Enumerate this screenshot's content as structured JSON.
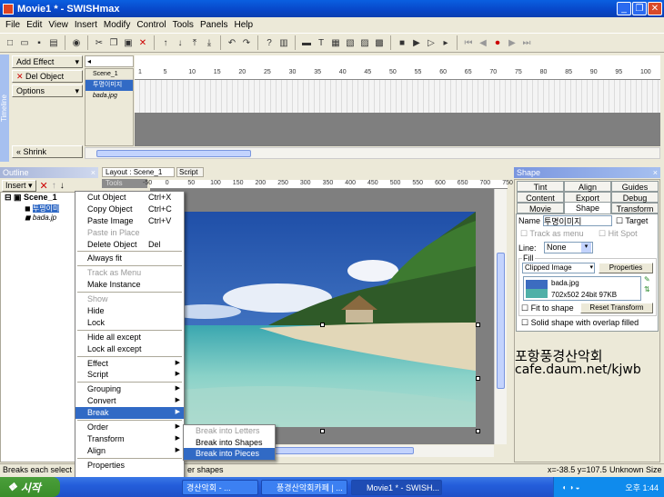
{
  "window": {
    "title": "Movie1 * - SWISHmax"
  },
  "menu": [
    "File",
    "Edit",
    "View",
    "Insert",
    "Modify",
    "Control",
    "Tools",
    "Panels",
    "Help"
  ],
  "timeline": {
    "add_effect": "Add Effect",
    "del_object": "Del Object",
    "options": "Options",
    "shrink": "Shrink",
    "side_label": "Timeline",
    "tracks": [
      "Scene_1",
      "투명이미지",
      "bada.jpg"
    ],
    "ruler_ticks": [
      "1",
      "5",
      "10",
      "15",
      "20",
      "25",
      "30",
      "35",
      "40",
      "45",
      "50",
      "55",
      "60",
      "65",
      "70",
      "75",
      "80",
      "85",
      "90",
      "95",
      "100"
    ]
  },
  "outline": {
    "title": "Outline",
    "insert": "Insert",
    "scene": "Scene_1",
    "items": [
      "투명이미",
      "bada.jp"
    ]
  },
  "layout": {
    "tab_layout": "Layout : Scene_1",
    "tab_script": "Script",
    "tools": "Tools",
    "ruler_ticks": [
      "-50",
      "0",
      "50",
      "100",
      "150",
      "200",
      "250",
      "300",
      "350",
      "400",
      "450",
      "500",
      "550",
      "600",
      "650",
      "700",
      "750"
    ]
  },
  "context_menu": [
    {
      "label": "Cut Object",
      "shortcut": "Ctrl+X",
      "state": "normal"
    },
    {
      "label": "Copy Object",
      "shortcut": "Ctrl+C",
      "state": "normal"
    },
    {
      "label": "Paste Image",
      "shortcut": "Ctrl+V",
      "state": "normal"
    },
    {
      "label": "Paste in Place",
      "shortcut": "",
      "state": "disabled"
    },
    {
      "label": "Delete Object",
      "shortcut": "Del",
      "state": "normal"
    },
    {
      "sep": true
    },
    {
      "label": "Always fit",
      "shortcut": "",
      "state": "normal"
    },
    {
      "sep": true
    },
    {
      "label": "Track as Menu",
      "shortcut": "",
      "state": "disabled"
    },
    {
      "label": "Make Instance",
      "shortcut": "",
      "state": "normal"
    },
    {
      "sep": true
    },
    {
      "label": "Show",
      "shortcut": "",
      "state": "disabled"
    },
    {
      "label": "Hide",
      "shortcut": "",
      "state": "normal"
    },
    {
      "label": "Lock",
      "shortcut": "",
      "state": "normal"
    },
    {
      "sep": true
    },
    {
      "label": "Hide all except",
      "shortcut": "",
      "state": "normal"
    },
    {
      "label": "Lock all except",
      "shortcut": "",
      "state": "normal"
    },
    {
      "sep": true
    },
    {
      "label": "Effect",
      "shortcut": "",
      "state": "normal",
      "sub": true
    },
    {
      "label": "Script",
      "shortcut": "",
      "state": "normal",
      "sub": true
    },
    {
      "sep": true
    },
    {
      "label": "Grouping",
      "shortcut": "",
      "state": "normal",
      "sub": true
    },
    {
      "label": "Convert",
      "shortcut": "",
      "state": "normal",
      "sub": true
    },
    {
      "label": "Break",
      "shortcut": "",
      "state": "selected",
      "sub": true
    },
    {
      "sep": true
    },
    {
      "label": "Order",
      "shortcut": "",
      "state": "normal",
      "sub": true
    },
    {
      "label": "Transform",
      "shortcut": "",
      "state": "normal",
      "sub": true
    },
    {
      "label": "Align",
      "shortcut": "",
      "state": "normal",
      "sub": true
    },
    {
      "sep": true
    },
    {
      "label": "Properties",
      "shortcut": "",
      "state": "normal"
    }
  ],
  "submenu": [
    {
      "label": "Break into Letters",
      "state": "disabled"
    },
    {
      "label": "Break into Shapes",
      "state": "normal"
    },
    {
      "label": "Break into Pieces",
      "state": "selected"
    }
  ],
  "shape_panel": {
    "title": "Shape",
    "tabs_row1": [
      "Tint",
      "Align",
      "Guides"
    ],
    "tabs_row2": [
      "Content",
      "Export",
      "Debug"
    ],
    "tabs_row3": [
      "Movie",
      "Shape",
      "Transform"
    ],
    "name_label": "Name",
    "name_value": "투명이미지",
    "target": "Target",
    "track_as_menu": "Track as menu",
    "hot_spot": "Hit Spot",
    "line_label": "Line:",
    "line_value": "None",
    "fill_label": "Fill",
    "fill_value": "Clipped Image",
    "properties": "Properties",
    "image_name": "bada.jpg",
    "image_info": "702x502 24bit 97KB",
    "fit_to_shape": "Fit to shape",
    "reset_transform": "Reset Transform",
    "solid_shape": "Solid shape with overlap filled"
  },
  "watermark": {
    "line1": "포항풍경산악회",
    "line2": "cafe.daum.net/kjwb"
  },
  "status": {
    "left": "Breaks each select",
    "mid": "er shapes",
    "coords": "x=-38.5 y=107.5",
    "size": "Unknown Size"
  },
  "taskbar": {
    "start": "시작",
    "items": [
      "경산악회 - ...",
      "풍경산악회카페 | ...",
      "Movie1 * - SWISH..."
    ],
    "clock": "오후 1:44"
  }
}
